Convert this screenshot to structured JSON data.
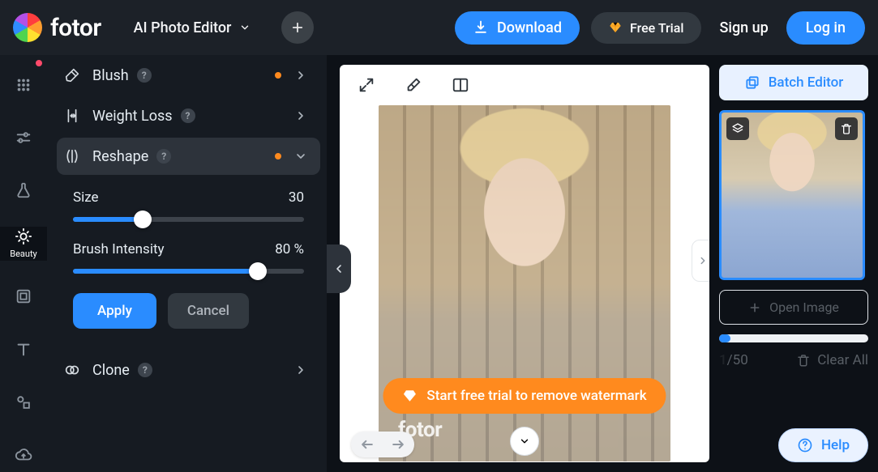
{
  "brand": "fotor",
  "header": {
    "editor_label": "AI Photo Editor",
    "download": "Download",
    "free_trial": "Free Trial",
    "sign_up": "Sign up",
    "log_in": "Log in"
  },
  "rail": {
    "beauty": "Beauty"
  },
  "tools": {
    "blush": "Blush",
    "weight_loss": "Weight Loss",
    "reshape": "Reshape",
    "clone": "Clone"
  },
  "reshape_controls": {
    "size_label": "Size",
    "size_value": "30",
    "size_pct": 30,
    "brush_label": "Brush Intensity",
    "brush_value": "80 %",
    "brush_pct": 80,
    "apply": "Apply",
    "cancel": "Cancel"
  },
  "canvas": {
    "watermark": "fotor",
    "trial_pill": "Start free trial to remove watermark"
  },
  "right": {
    "batch_editor": "Batch Editor",
    "open_image": "Open Image",
    "current": "1",
    "total": "/50",
    "clear_all": "Clear All",
    "help": "Help"
  }
}
